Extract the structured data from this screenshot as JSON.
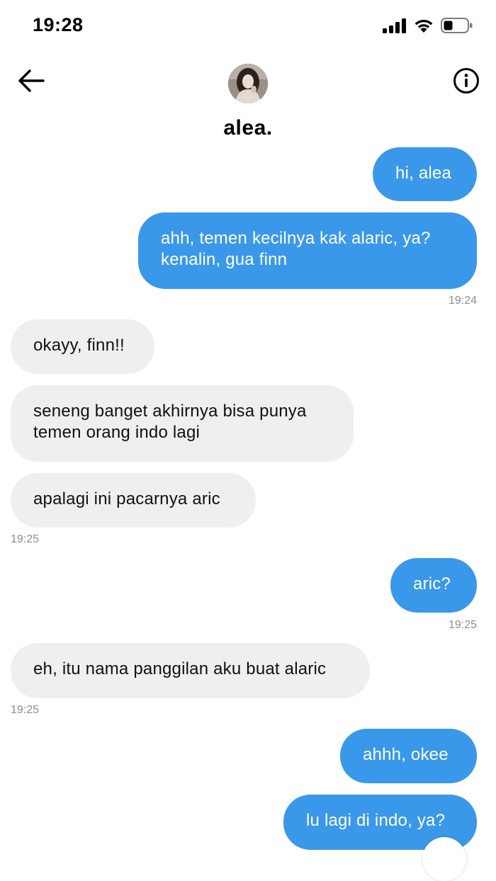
{
  "status_bar": {
    "time": "19:28",
    "icons": [
      "cellular-signal-icon",
      "wifi-icon",
      "battery-icon"
    ]
  },
  "header": {
    "contact_name": "alea.",
    "back_icon": "arrow-left-icon",
    "info_icon": "info-icon"
  },
  "messages": [
    {
      "side": "sent",
      "text": "hi, alea"
    },
    {
      "side": "sent",
      "text": "ahh, temen kecilnya kak alaric, ya? kenalin, gua finn",
      "timestamp": "19:24"
    },
    {
      "side": "received",
      "text": "okayy, finn!!"
    },
    {
      "side": "received",
      "text": "seneng banget akhirnya bisa punya temen orang indo lagi"
    },
    {
      "side": "received",
      "text": "apalagi ini pacarnya aric",
      "timestamp": "19:25"
    },
    {
      "side": "sent",
      "text": "aric?",
      "timestamp": "19:25"
    },
    {
      "side": "received",
      "text": "eh, itu nama panggilan aku buat alaric",
      "timestamp": "19:25"
    },
    {
      "side": "sent",
      "text": "ahhh, okee"
    },
    {
      "side": "sent",
      "text": "lu lagi di indo, ya?"
    }
  ],
  "colors": {
    "sent_bubble": "#3a98ea",
    "received_bubble": "#efeff2",
    "timestamp": "#8e8e93"
  }
}
